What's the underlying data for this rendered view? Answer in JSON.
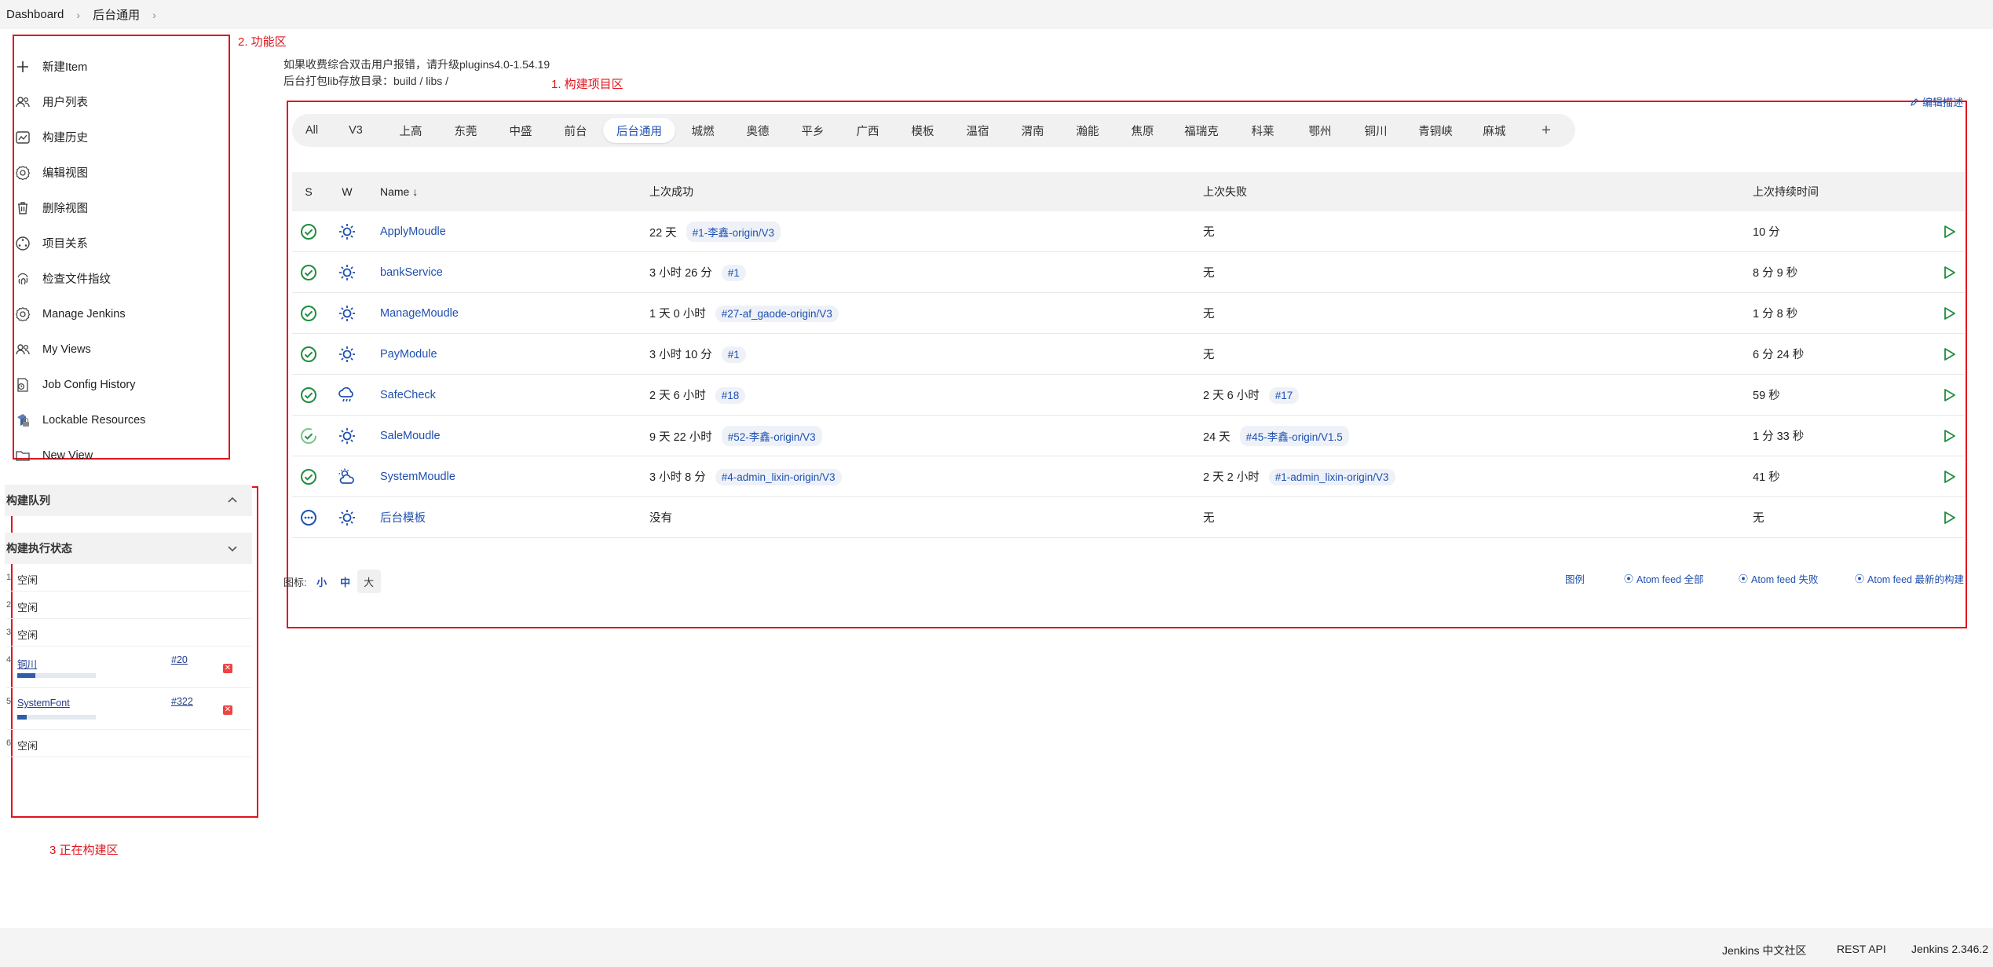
{
  "breadcrumb": [
    "Dashboard",
    "后台通用"
  ],
  "annotations": {
    "functions": "2. 功能区",
    "projects": "1. 构建项目区",
    "building": "3 正在构建区"
  },
  "sidebar": {
    "tasks": [
      {
        "label": "新建Item",
        "icon": "plus-icon"
      },
      {
        "label": "用户列表",
        "icon": "users-icon"
      },
      {
        "label": "构建历史",
        "icon": "history-icon"
      },
      {
        "label": "编辑视图",
        "icon": "gear-icon"
      },
      {
        "label": "删除视图",
        "icon": "trash-icon"
      },
      {
        "label": "项目关系",
        "icon": "relation-icon"
      },
      {
        "label": "检查文件指纹",
        "icon": "fingerprint-icon"
      },
      {
        "label": "Manage Jenkins",
        "icon": "gear-icon"
      },
      {
        "label": "My Views",
        "icon": "users-icon"
      },
      {
        "label": "Job Config History",
        "icon": "config-history-icon"
      },
      {
        "label": "Lockable Resources",
        "icon": "lock-resource-icon"
      },
      {
        "label": "New View",
        "icon": "folder-icon"
      }
    ]
  },
  "queue": {
    "title": "构建队列"
  },
  "executors": {
    "title": "构建执行状态",
    "items": [
      {
        "num": "1",
        "text": "空闲"
      },
      {
        "num": "2",
        "text": "空闲"
      },
      {
        "num": "3",
        "text": "空闲"
      },
      {
        "num": "4",
        "job": "铜川",
        "build": "#20",
        "progress": 0.23
      },
      {
        "num": "5",
        "job": "SystemFont",
        "build": "#322",
        "progress": 0.12
      },
      {
        "num": "6",
        "text": "空闲"
      }
    ]
  },
  "description": {
    "line1": "如果收费综合双击用户报错，请升级plugins4.0-1.54.19",
    "line2": "后台打包lib存放目录：build / libs /",
    "edit": "编辑描述"
  },
  "tabs": [
    "All",
    "V3",
    "上高",
    "东莞",
    "中盛",
    "前台",
    "后台通用",
    "城燃",
    "奥德",
    "平乡",
    "广西",
    "模板",
    "温宿",
    "渭南",
    "瀚能",
    "焦原",
    "福瑞克",
    "科莱",
    "鄂州",
    "铜川",
    "青铜峡",
    "麻城",
    "+"
  ],
  "active_tab": "后台通用",
  "table": {
    "headers": {
      "s": "S",
      "w": "W",
      "name": "Name ↓",
      "last_success": "上次成功",
      "last_failure": "上次失败",
      "last_duration": "上次持续时间"
    },
    "rows": [
      {
        "name": "ApplyMoudle",
        "status": "success",
        "weather": "sunny",
        "success_time": "22 天",
        "success_build": "#1-李鑫-origin/V3",
        "failure_time": "无",
        "failure_build": "",
        "duration": "10 分"
      },
      {
        "name": "bankService",
        "status": "success",
        "weather": "sunny",
        "success_time": "3 小时 26 分",
        "success_build": "#1",
        "failure_time": "无",
        "failure_build": "",
        "duration": "8 分 9 秒"
      },
      {
        "name": "ManageMoudle",
        "status": "success",
        "weather": "sunny",
        "success_time": "1 天 0 小时",
        "success_build": "#27-af_gaode-origin/V3",
        "failure_time": "无",
        "failure_build": "",
        "duration": "1 分 8 秒"
      },
      {
        "name": "PayModule",
        "status": "success",
        "weather": "sunny",
        "success_time": "3 小时 10 分",
        "success_build": "#1",
        "failure_time": "无",
        "failure_build": "",
        "duration": "6 分 24 秒"
      },
      {
        "name": "SafeCheck",
        "status": "success",
        "weather": "rainy",
        "success_time": "2 天 6 小时",
        "success_build": "#18",
        "failure_time": "2 天 6 小时",
        "failure_build": "#17",
        "duration": "59 秒"
      },
      {
        "name": "SaleMoudle",
        "status": "success-building",
        "weather": "sunny",
        "success_time": "9 天 22 小时",
        "success_build": "#52-李鑫-origin/V3",
        "failure_time": "24 天",
        "failure_build": "#45-李鑫-origin/V1.5",
        "duration": "1 分 33 秒"
      },
      {
        "name": "SystemMoudle",
        "status": "success",
        "weather": "partly-cloudy",
        "success_time": "3 小时 8 分",
        "success_build": "#4-admin_lixin-origin/V3",
        "failure_time": "2 天 2 小时",
        "failure_build": "#1-admin_lixin-origin/V3",
        "duration": "41 秒"
      },
      {
        "name": "后台模板",
        "status": "not-built",
        "weather": "sunny",
        "success_time": "没有",
        "success_build": "",
        "failure_time": "无",
        "failure_build": "",
        "duration": "无"
      }
    ]
  },
  "icon_size": {
    "label": "图标:",
    "options": [
      "小",
      "中",
      "大"
    ],
    "selected": "大"
  },
  "feeds": {
    "legend": "图例",
    "all": "Atom feed 全部",
    "failures": "Atom feed 失败",
    "latest": "Atom feed 最新的构建"
  },
  "footer": {
    "community": "Jenkins 中文社区",
    "rest": "REST API",
    "version": "Jenkins 2.346.2"
  },
  "colors": {
    "link": "#1f50b0",
    "success": "#1e8e3e",
    "annotation": "#e0141e",
    "play": "#1e8e3e"
  }
}
